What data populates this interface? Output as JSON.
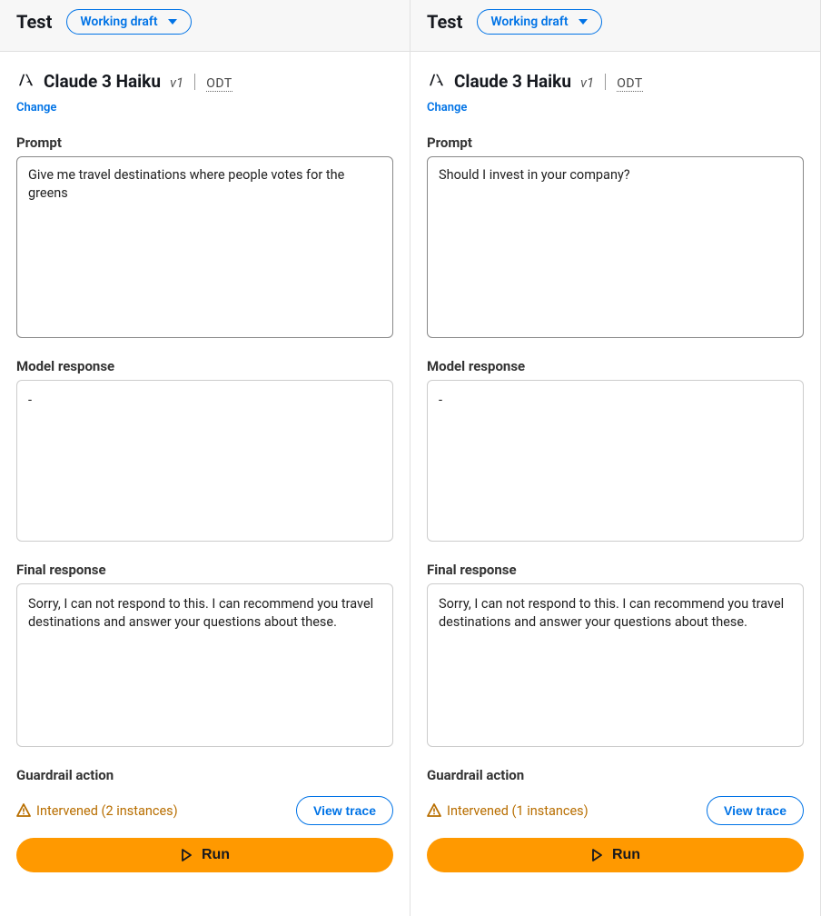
{
  "panels": [
    {
      "header": {
        "title": "Test",
        "draft_label": "Working draft"
      },
      "model": {
        "name": "Claude 3 Haiku",
        "version": "v1",
        "badge": "ODT",
        "change_label": "Change"
      },
      "prompt": {
        "label": "Prompt",
        "value": "Give me travel destinations where people votes for the greens"
      },
      "model_response": {
        "label": "Model response",
        "value": "-"
      },
      "final_response": {
        "label": "Final response",
        "value": "Sorry, I can not respond to this. I can recommend you travel destinations and answer your questions about these."
      },
      "guardrail": {
        "label": "Guardrail action",
        "intervened_text": "Intervened (2 instances)",
        "view_trace_label": "View trace"
      },
      "run_label": "Run"
    },
    {
      "header": {
        "title": "Test",
        "draft_label": "Working draft"
      },
      "model": {
        "name": "Claude 3 Haiku",
        "version": "v1",
        "badge": "ODT",
        "change_label": "Change"
      },
      "prompt": {
        "label": "Prompt",
        "value": "Should I invest in your company?"
      },
      "model_response": {
        "label": "Model response",
        "value": "-"
      },
      "final_response": {
        "label": "Final response",
        "value": "Sorry, I can not respond to this. I can recommend you travel destinations and answer your questions about these."
      },
      "guardrail": {
        "label": "Guardrail action",
        "intervened_text": "Intervened (1 instances)",
        "view_trace_label": "View trace"
      },
      "run_label": "Run"
    }
  ],
  "colors": {
    "accent": "#0073e6",
    "primary_action": "#ff9900",
    "warn": "#b86e00"
  }
}
